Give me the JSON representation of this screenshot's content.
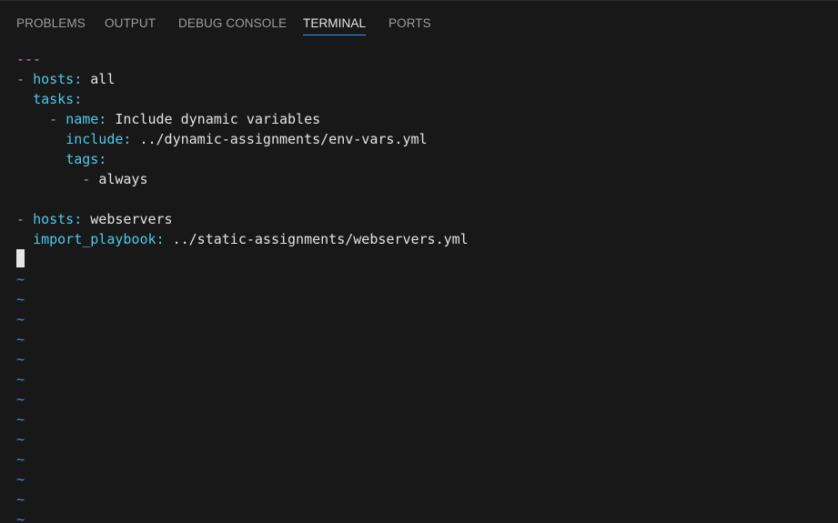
{
  "tabs": [
    {
      "label": "PROBLEMS"
    },
    {
      "label": "OUTPUT"
    },
    {
      "label": "DEBUG CONSOLE"
    },
    {
      "label": "TERMINAL"
    },
    {
      "label": "PORTS"
    }
  ],
  "active_tab": "TERMINAL",
  "terminal": {
    "doc_start": "---",
    "play1": {
      "dash": "-",
      "hosts_key": "hosts:",
      "hosts_value": "all",
      "tasks_key": "tasks:",
      "task_dash": "-",
      "name_key": "name:",
      "name_value": "Include dynamic variables",
      "include_key": "include:",
      "include_value": "../dynamic-assignments/env-vars.yml",
      "tags_key": "tags:",
      "tag_dash": "-",
      "tag_value": "always"
    },
    "play2": {
      "dash": "-",
      "hosts_key": "hosts:",
      "hosts_value": "webservers",
      "import_key": "import_playbook:",
      "import_value": "../static-assignments/webservers.yml"
    },
    "empty_line_marker": "~"
  },
  "colors": {
    "background": "#181818",
    "tab_active": "#e7e7e7",
    "tab_inactive": "#9d9d9d",
    "tab_underline": "#3794ff",
    "yaml_key": "#4ec9e8",
    "yaml_dash": "#c586c0",
    "tilde": "#3b8eea"
  }
}
